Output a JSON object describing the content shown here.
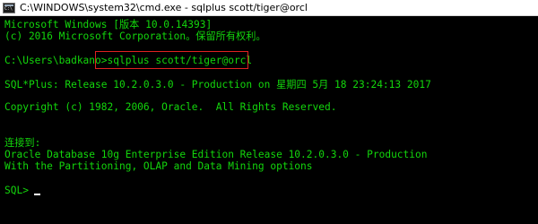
{
  "window": {
    "title": "C:\\WINDOWS\\system32\\cmd.exe - sqlplus  scott/tiger@orcl"
  },
  "console": {
    "lines": [
      "Microsoft Windows [版本 10.0.14393]",
      "(c) 2016 Microsoft Corporation。保留所有权利。",
      "",
      "C:\\Users\\badkano>sqlplus scott/tiger@orcl",
      "",
      "SQL*Plus: Release 10.2.0.3.0 - Production on 星期四 5月 18 23:24:13 2017",
      "",
      "Copyright (c) 1982, 2006, Oracle.  All Rights Reserved.",
      "",
      "",
      "连接到:",
      "Oracle Database 10g Enterprise Edition Release 10.2.0.3.0 - Production",
      "With the Partitioning, OLAP and Data Mining options",
      "",
      "SQL> "
    ]
  },
  "colors": {
    "console_text": "#13d60c",
    "background": "#000000",
    "highlight": "#e02020"
  },
  "icons": {
    "title_icon": "cmd-icon"
  }
}
